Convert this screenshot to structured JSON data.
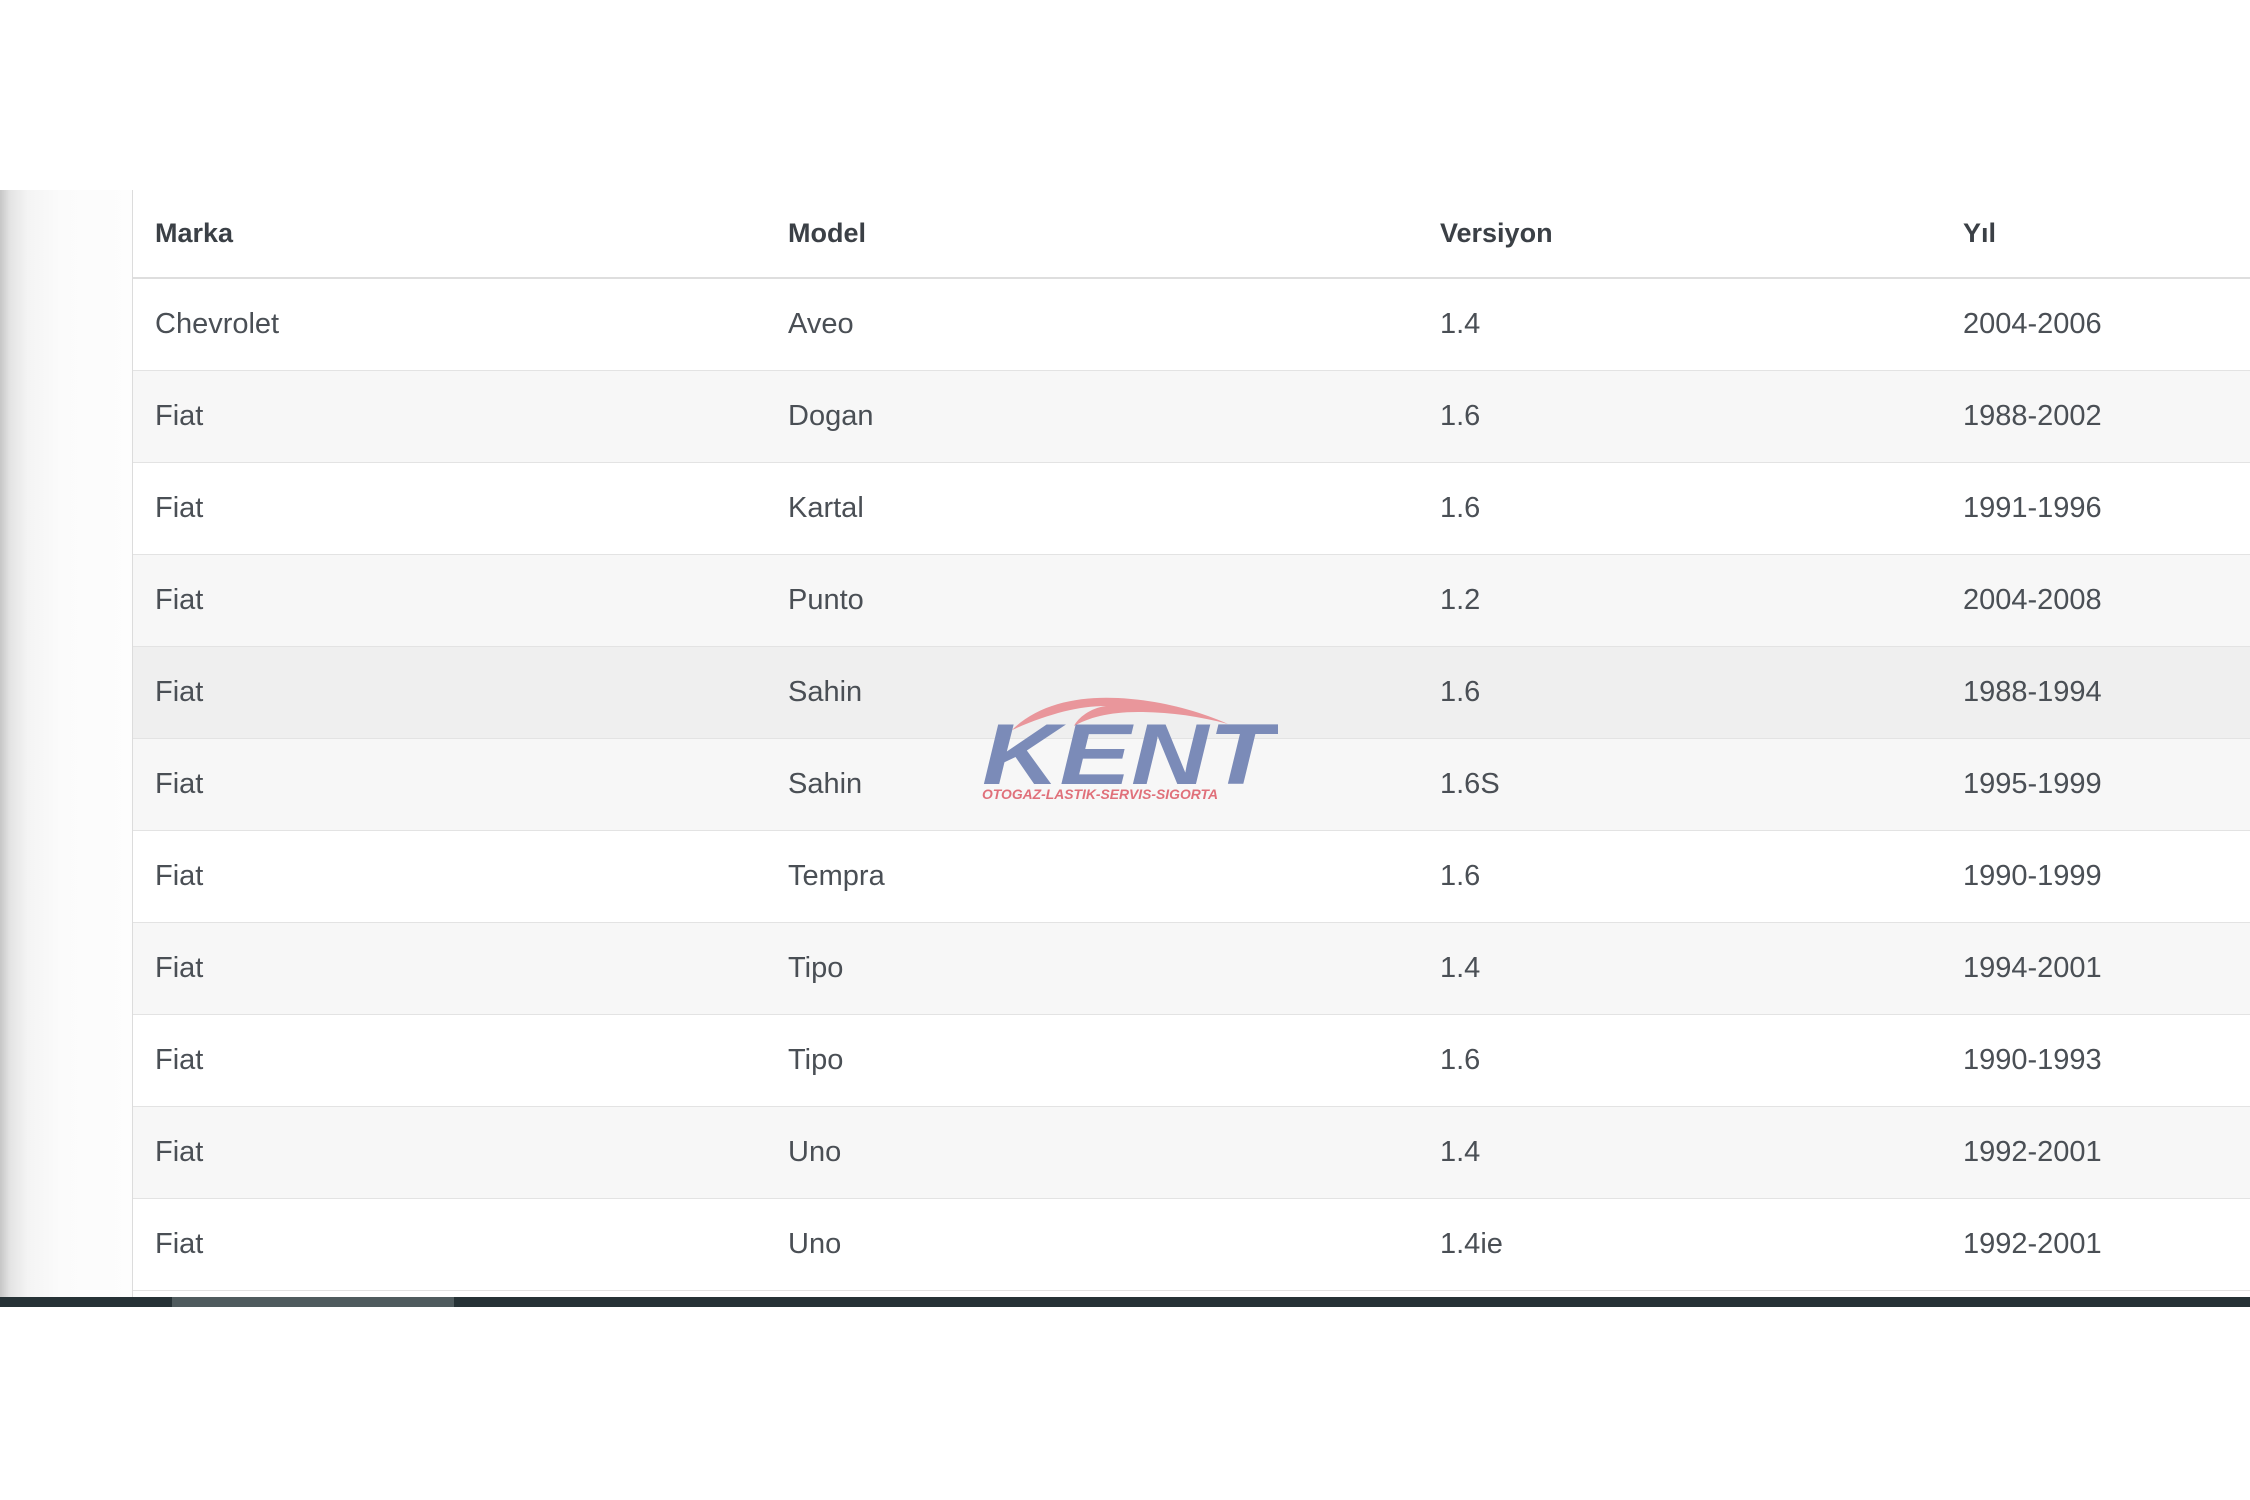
{
  "table": {
    "columns": [
      "Marka",
      "Model",
      "Versiyon",
      "Yıl"
    ],
    "rows": [
      [
        "Chevrolet",
        "Aveo",
        "1.4",
        "2004-2006"
      ],
      [
        "Fiat",
        "Dogan",
        "1.6",
        "1988-2002"
      ],
      [
        "Fiat",
        "Kartal",
        "1.6",
        "1991-1996"
      ],
      [
        "Fiat",
        "Punto",
        "1.2",
        "2004-2008"
      ],
      [
        "Fiat",
        "Sahin",
        "1.6",
        "1988-1994"
      ],
      [
        "Fiat",
        "Sahin",
        "1.6S",
        "1995-1999"
      ],
      [
        "Fiat",
        "Tempra",
        "1.6",
        "1990-1999"
      ],
      [
        "Fiat",
        "Tipo",
        "1.4",
        "1994-2001"
      ],
      [
        "Fiat",
        "Tipo",
        "1.6",
        "1990-1993"
      ],
      [
        "Fiat",
        "Uno",
        "1.4",
        "1992-2001"
      ],
      [
        "Fiat",
        "Uno",
        "1.4ie",
        "1992-2001"
      ]
    ],
    "hovered_row": 4
  },
  "watermark": {
    "brand": "KENT",
    "tagline": "OTOGAZ-LASTIK-SERVIS-SIGORTA",
    "colors": {
      "brand": "#7b8bb8",
      "tagline": "#e0707a",
      "swoosh": "#e8868c"
    }
  },
  "colors": {
    "header_text": "#3b4046",
    "cell_text": "#4a4f55",
    "row_stripe": "#f7f7f7",
    "row_hover": "#efefef",
    "scrollbar": "#263236",
    "scrollbar_thumb": "#4f5b5e"
  }
}
